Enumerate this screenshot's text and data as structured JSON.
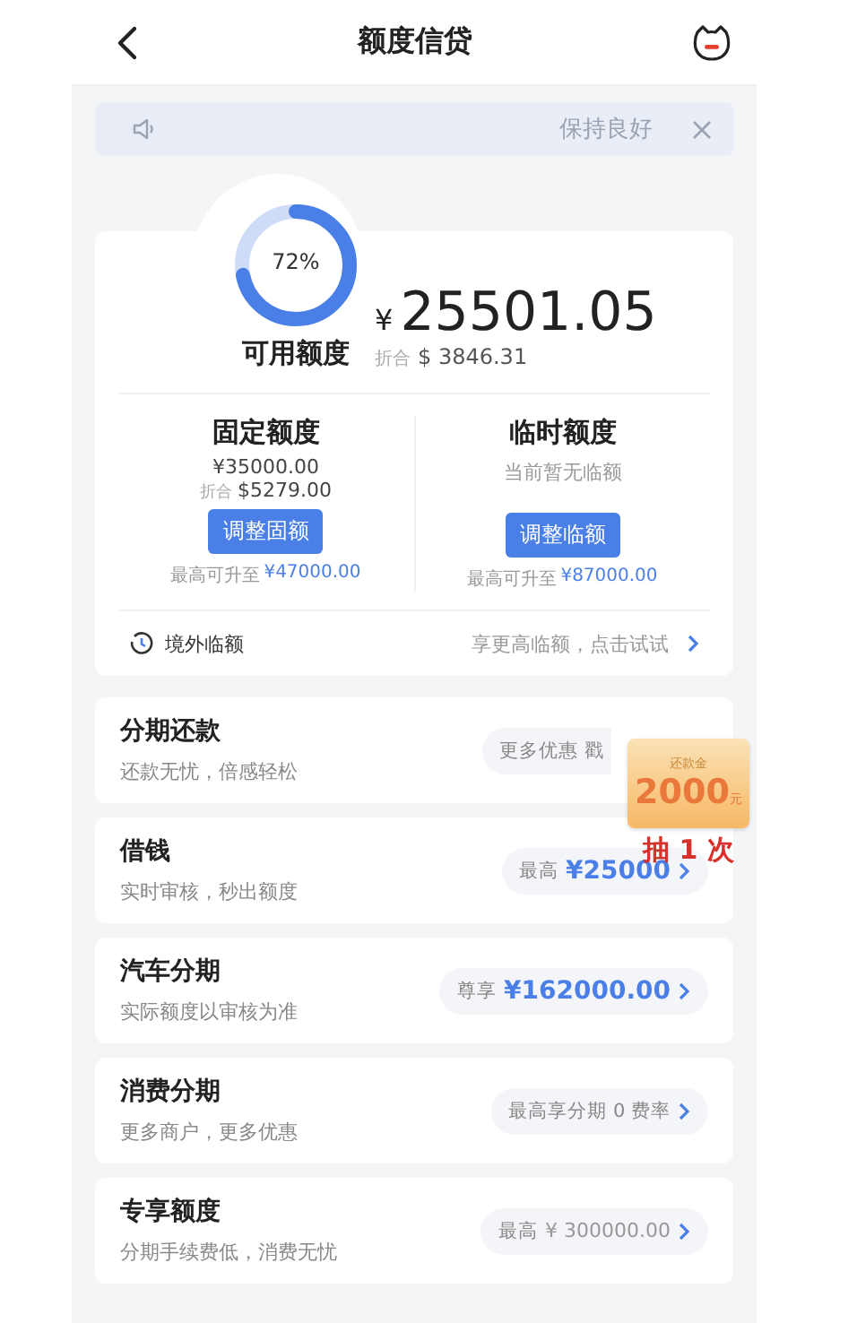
{
  "header": {
    "title": "额度信贷"
  },
  "notice": {
    "text": "保持良好"
  },
  "summary": {
    "level": 0.72,
    "percent": "72%",
    "label": "可用额度",
    "currency": "¥",
    "amount": "25501.05",
    "converted_label": "折合",
    "converted": "$ 3846.31"
  },
  "limits": [
    {
      "title": "固定额度",
      "lines": [
        {
          "kind": "amount",
          "text": "¥35000.00"
        },
        {
          "kind": "converted",
          "prefix": "折合",
          "text": "$5279.00"
        }
      ],
      "button": "调整固额",
      "max_label": "最高可升至",
      "max_value": "¥47000.00"
    },
    {
      "title": "临时额度",
      "lines": [
        {
          "kind": "note",
          "text": "当前暂无临额"
        }
      ],
      "button": "调整临额",
      "max_label": "最高可升至",
      "max_value": "¥87000.00"
    }
  ],
  "overseas": {
    "label": "境外临额",
    "hint": "享更高临额，点击试试"
  },
  "products": [
    {
      "title": "分期还款",
      "subtitle": "还款无忧，倍感轻松",
      "pill": {
        "prefix": "更多优惠 戳"
      }
    },
    {
      "title": "借钱",
      "subtitle": "实时审核，秒出额度",
      "pill": {
        "prefix": "最高",
        "value": "¥25000",
        "emphasis": true
      }
    },
    {
      "title": "汽车分期",
      "subtitle": "实际额度以审核为准",
      "pill": {
        "prefix": "尊享",
        "value": "¥162000.00",
        "emphasis": true
      }
    },
    {
      "title": "消费分期",
      "subtitle": "更多商户，更多优惠",
      "pill": {
        "prefix": "最高享分期 0 费率"
      }
    },
    {
      "title": "专享额度",
      "subtitle": "分期手续费低，消费无忧",
      "pill": {
        "prefix": "最高",
        "value": "¥ 300000.00",
        "emphasis": false
      }
    }
  ],
  "coupon": {
    "caption": "还款金",
    "amount": "2000",
    "unit": "元",
    "action": "抽 1 次"
  }
}
